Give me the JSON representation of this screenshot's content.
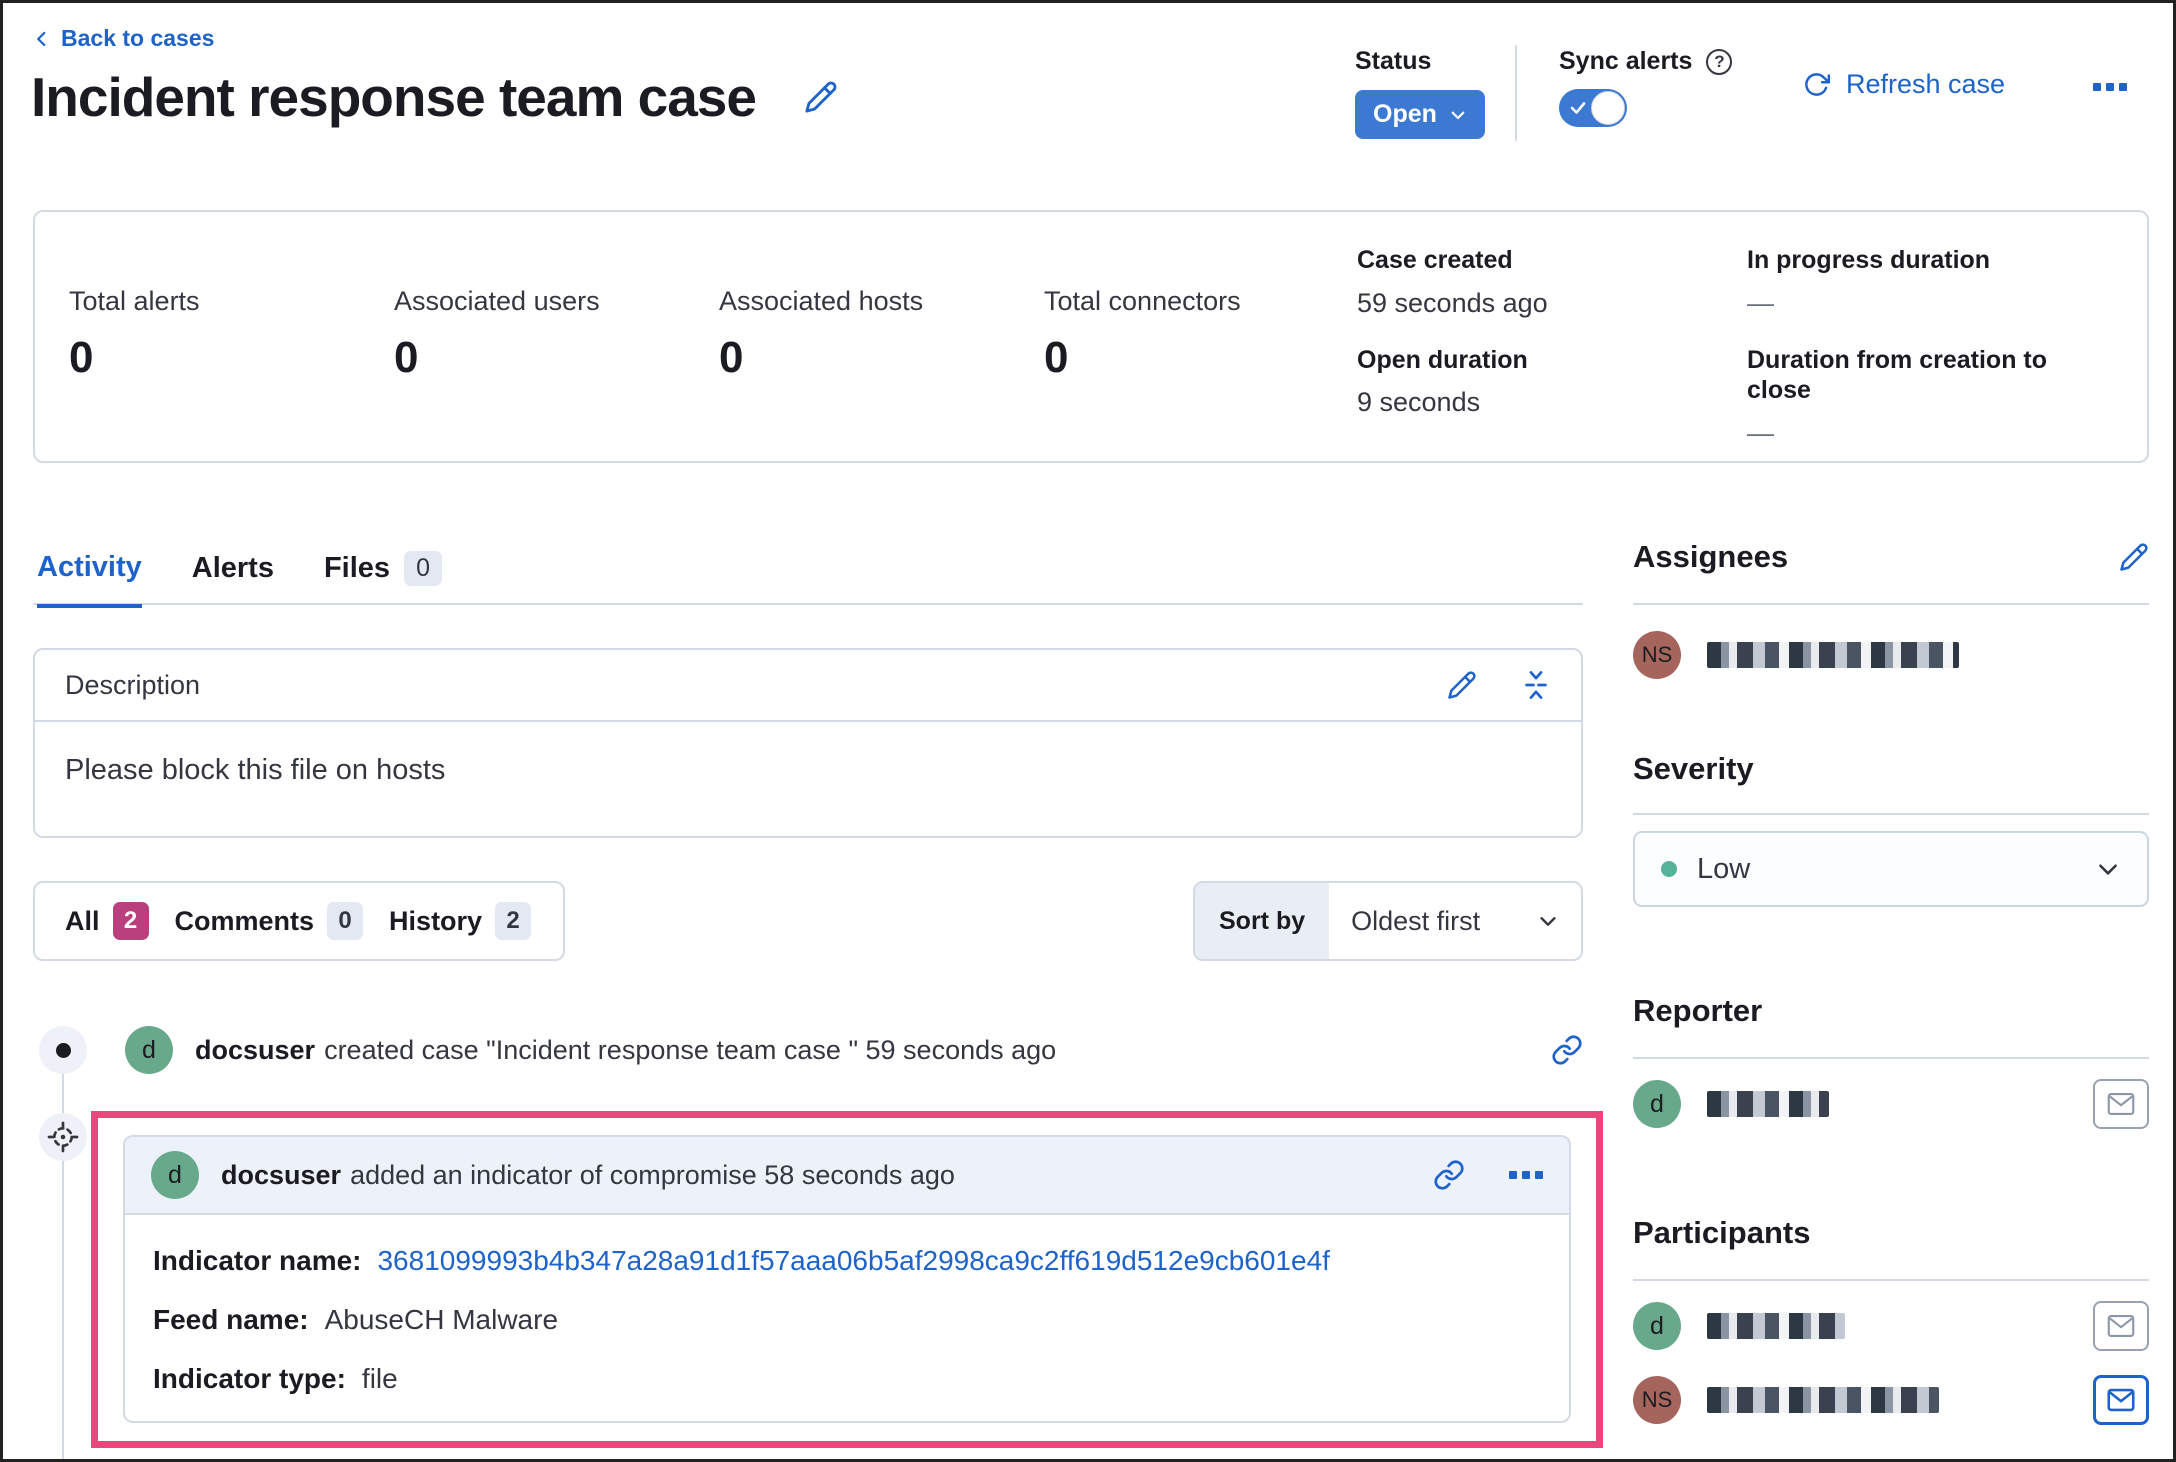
{
  "colors": {
    "link": "#1e63c9",
    "btn-blue": "#3b79d2",
    "accent-pink": "#e8487c",
    "badge-pink": "#b9407c",
    "badge-gray": "#e3e8f2",
    "avatar-green": "#68a98b",
    "avatar-brown": "#a5655c",
    "severity-green": "#54b399",
    "border": "#d3dae6",
    "text": "#343741",
    "text-dark": "#1a1c21",
    "header-bg": "#edf1f9"
  },
  "header": {
    "back": "Back to cases",
    "title": "Incident response team case",
    "status_label": "Status",
    "status_value": "Open",
    "sync_label": "Sync alerts",
    "help": "?",
    "refresh": "Refresh case"
  },
  "stats": {
    "items": [
      {
        "label": "Total alerts",
        "value": "0"
      },
      {
        "label": "Associated users",
        "value": "0"
      },
      {
        "label": "Associated hosts",
        "value": "0"
      },
      {
        "label": "Total connectors",
        "value": "0"
      }
    ],
    "meta_left": [
      {
        "label": "Case created",
        "value": "59 seconds ago"
      },
      {
        "label": "Open duration",
        "value": "9 seconds"
      }
    ],
    "meta_right": [
      {
        "label": "In progress duration",
        "value": "—"
      },
      {
        "label": "Duration from creation to close",
        "value": "—"
      }
    ]
  },
  "tabs": [
    {
      "label": "Activity"
    },
    {
      "label": "Alerts"
    },
    {
      "label": "Files",
      "badge": "0"
    }
  ],
  "description": {
    "title": "Description",
    "body": "Please block this file on hosts"
  },
  "filters": {
    "all_label": "All",
    "all_count": "2",
    "comments_label": "Comments",
    "comments_count": "0",
    "history_label": "History",
    "history_count": "2",
    "sort_label": "Sort by",
    "sort_value": "Oldest first"
  },
  "timeline": {
    "event": {
      "avatar": "d",
      "user": "docsuser",
      "text": "created case \"Incident response team case \" 59 seconds ago"
    },
    "comment": {
      "avatar": "d",
      "user": "docsuser",
      "action": "added an indicator of compromise 58 seconds ago",
      "fields": [
        {
          "label": "Indicator name:",
          "value": "3681099993b4b347a28a91d1f57aaa06b5af2998ca9c2ff619d512e9cb601e4f"
        },
        {
          "label": "Feed name:",
          "value": "AbuseCH Malware"
        },
        {
          "label": "Indicator type:",
          "value": "file"
        }
      ]
    }
  },
  "sidebar": {
    "assignees": {
      "title": "Assignees",
      "user": {
        "initials": "NS"
      }
    },
    "severity": {
      "title": "Severity",
      "value": "Low"
    },
    "reporter": {
      "title": "Reporter",
      "user": {
        "initials": "d"
      }
    },
    "participants": {
      "title": "Participants",
      "users": [
        {
          "initials": "d"
        },
        {
          "initials": "NS"
        }
      ]
    }
  }
}
